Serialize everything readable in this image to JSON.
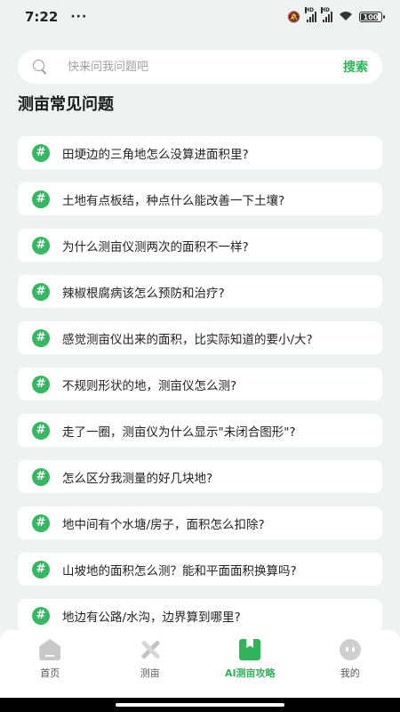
{
  "status_bar": {
    "time": "7:22",
    "dots": "···",
    "signal_1_label": "HD",
    "signal_2_label": "HD",
    "battery_level": "100"
  },
  "search": {
    "placeholder": "快来问我问题吧",
    "button_label": "搜索"
  },
  "section_title": "测亩常见问题",
  "faq": [
    {
      "icon": "#",
      "text": "田埂边的三角地怎么没算进面积里?"
    },
    {
      "icon": "#",
      "text": "土地有点板结，种点什么能改善一下土壤?"
    },
    {
      "icon": "#",
      "text": "为什么测亩仪测两次的面积不一样?"
    },
    {
      "icon": "#",
      "text": "辣椒根腐病该怎么预防和治疗?"
    },
    {
      "icon": "#",
      "text": "感觉测亩仪出来的面积，比实际知道的要小/大?"
    },
    {
      "icon": "#",
      "text": "不规则形状的地，测亩仪怎么测?"
    },
    {
      "icon": "#",
      "text": "走了一圈，测亩仪为什么显示\"未闭合图形\"?"
    },
    {
      "icon": "#",
      "text": "怎么区分我测量的好几块地?"
    },
    {
      "icon": "#",
      "text": "地中间有个水塘/房子，面积怎么扣除?"
    },
    {
      "icon": "#",
      "text": "山坡地的面积怎么测？能和平面面积换算吗?"
    },
    {
      "icon": "#",
      "text": "地边有公路/水沟，边界算到哪里?"
    }
  ],
  "tabs": [
    {
      "label": "首页",
      "icon": "home-icon"
    },
    {
      "label": "测亩",
      "icon": "measure-icon"
    },
    {
      "label": "AI测亩攻略",
      "icon": "book-icon",
      "active": true
    },
    {
      "label": "我的",
      "icon": "profile-icon"
    }
  ],
  "colors": {
    "accent": "#2fb45a",
    "background": "#eef3f1",
    "card": "#ffffff"
  }
}
